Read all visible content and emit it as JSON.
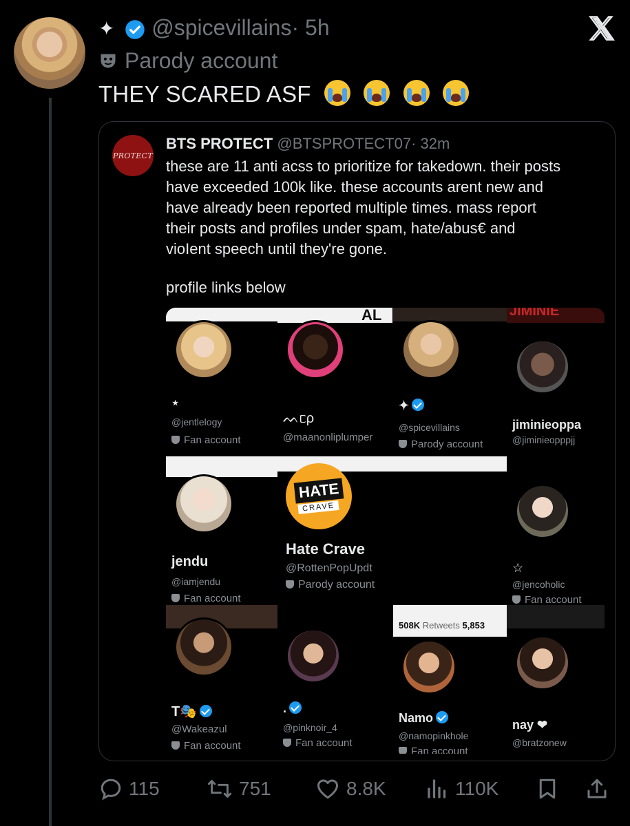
{
  "post": {
    "star": "✦",
    "handle": "@spicevillains",
    "time": "· 5h",
    "parody_label": "Parody account",
    "text": "THEY SCARED ASF"
  },
  "quote": {
    "avatar_text": "PROTECT",
    "name": "BTS PROTECT",
    "handle": "@BTSPROTECT07",
    "time": "· 32m",
    "lines": [
      "these are 11 anti acss to prioritize for takedown. their posts",
      "have exceeded 100k like. these accounts arent new and",
      "have already been reported multiple times. mass report",
      "their posts and profiles under spam, hate/abus€ and",
      "vioIent speech until they're gone."
    ],
    "links_text": "profile links below"
  },
  "grid": {
    "cells": [
      {
        "name": "⋆",
        "handle": "@jentlelogy",
        "label": "Fan account"
      },
      {
        "banner_text": "AL",
        "name": "ᨓᥴρ",
        "handle": "@maanonliplumper",
        "label": ""
      },
      {
        "name": "✦",
        "handle": "@spicevillains",
        "label": "Parody account"
      },
      {
        "banner_text": "JIMINIE",
        "name": "jiminieoppa",
        "handle": "@jiminieopppjj",
        "label": ""
      },
      {
        "name": "jendu",
        "handle": "@iamjendu",
        "label": "Fan account"
      },
      {
        "logo_top": "HATE",
        "logo_bottom": "CRAVE",
        "name": "Hate Crave",
        "handle": "@RottenPopUpdt",
        "label": "Parody account"
      },
      {
        "name": "☆",
        "handle": "@jencoholic",
        "label": "Fan account"
      },
      {
        "name": "T🎭",
        "handle": "@Wakeazul",
        "label": "Fan account"
      },
      {
        "name": ".",
        "handle": "@pinknoir_4",
        "label": "Fan account"
      },
      {
        "strip_bold": "508K",
        "strip_muted": "Retweets",
        "strip_num": "5,853",
        "name": "Namo",
        "handle": "@namopinkhole",
        "label": "Fan account"
      },
      {
        "name": "nay ❤",
        "handle": "@bratzonew",
        "label": ""
      }
    ]
  },
  "actions": {
    "replies": "115",
    "reposts": "751",
    "likes": "8.8K",
    "views": "110K"
  },
  "colors": {
    "background": "#000000",
    "text": "#e7e9ea",
    "muted": "#71767b",
    "verified": "#1d9bf0",
    "border": "#2f3336"
  }
}
